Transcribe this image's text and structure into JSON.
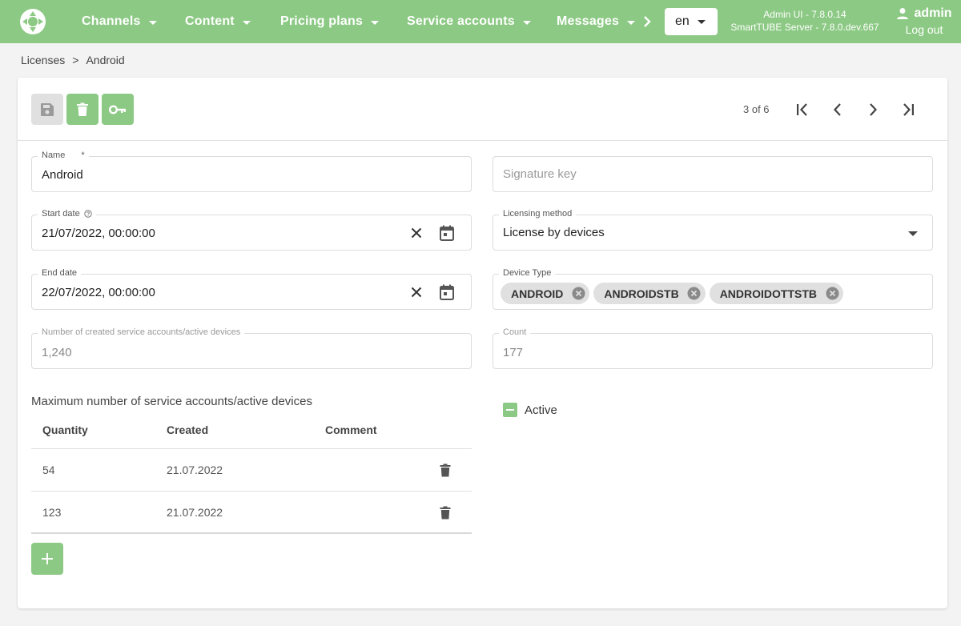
{
  "nav": {
    "items": [
      {
        "label": "Channels"
      },
      {
        "label": "Content"
      },
      {
        "label": "Pricing plans"
      },
      {
        "label": "Service accounts"
      },
      {
        "label": "Messages"
      }
    ],
    "language": "en",
    "version_line1": "Admin UI - 7.8.0.14",
    "version_line2": "SmartTUBE Server - 7.8.0.dev.667",
    "user": "admin",
    "logout": "Log out"
  },
  "breadcrumb": {
    "parent": "Licenses",
    "separator": ">",
    "current": "Android"
  },
  "pager": {
    "text": "3 of 6"
  },
  "form": {
    "name": {
      "label": "Name",
      "required_mark": "*",
      "value": "Android"
    },
    "signature_key": {
      "placeholder": "Signature key"
    },
    "start_date": {
      "label": "Start date",
      "value": "21/07/2022, 00:00:00"
    },
    "licensing_method": {
      "label": "Licensing method",
      "value": "License by devices"
    },
    "end_date": {
      "label": "End date",
      "value": "22/07/2022, 00:00:00"
    },
    "device_type": {
      "label": "Device Type",
      "chips": [
        {
          "label": "ANDROID"
        },
        {
          "label": "ANDROIDSTB"
        },
        {
          "label": "ANDROIDOTTSTB"
        }
      ]
    },
    "created_count": {
      "label": "Number of created service accounts/active devices",
      "value": "1,240"
    },
    "count": {
      "label": "Count",
      "value": "177"
    },
    "active": {
      "label": "Active"
    }
  },
  "max_table": {
    "title": "Maximum number of service accounts/active devices",
    "headers": {
      "quantity": "Quantity",
      "created": "Created",
      "comment": "Comment"
    },
    "rows": [
      {
        "quantity": "54",
        "created": "21.07.2022",
        "comment": ""
      },
      {
        "quantity": "123",
        "created": "21.07.2022",
        "comment": ""
      }
    ]
  },
  "colors": {
    "accent": "#8cc984",
    "disabled": "#e0e0e0"
  },
  "icons": {
    "logo": "logo-icon",
    "save": "save-icon",
    "delete": "delete-icon",
    "key": "key-icon",
    "first": "first-page-icon",
    "prev": "chevron-left-icon",
    "next": "chevron-right-icon",
    "last": "last-page-icon",
    "clear": "close-icon",
    "calendar": "calendar-icon",
    "add": "plus-icon"
  }
}
